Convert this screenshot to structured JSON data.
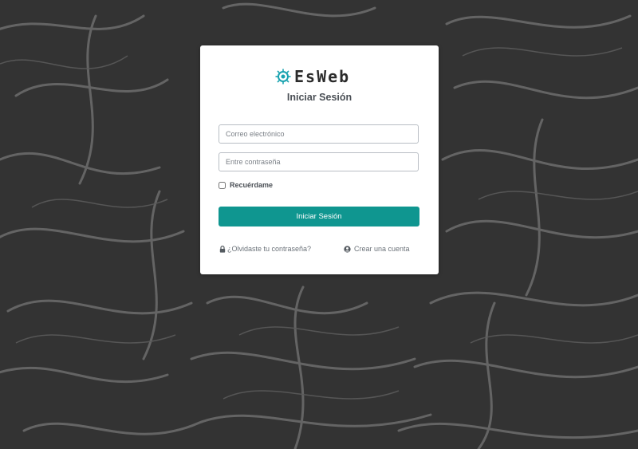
{
  "logo": {
    "brand": "EsWeb",
    "icon": "chip-gear-icon"
  },
  "title": "Iniciar Sesión",
  "form": {
    "email_placeholder": "Correo electrónico",
    "password_placeholder": "Entre contraseña",
    "remember_label": "Recuérdame",
    "remember_checked": false,
    "submit_label": "Iniciar Sesión"
  },
  "links": {
    "forgot_label": "¿Olvidaste tu contraseña?",
    "forgot_icon": "lock-icon",
    "create_label": "Crear una cuenta",
    "create_icon": "user-circle-icon"
  },
  "colors": {
    "background": "#333333",
    "pattern": "#6a6a6a",
    "accent": "#0f9690",
    "logo_icon": "#1aa3b0"
  }
}
